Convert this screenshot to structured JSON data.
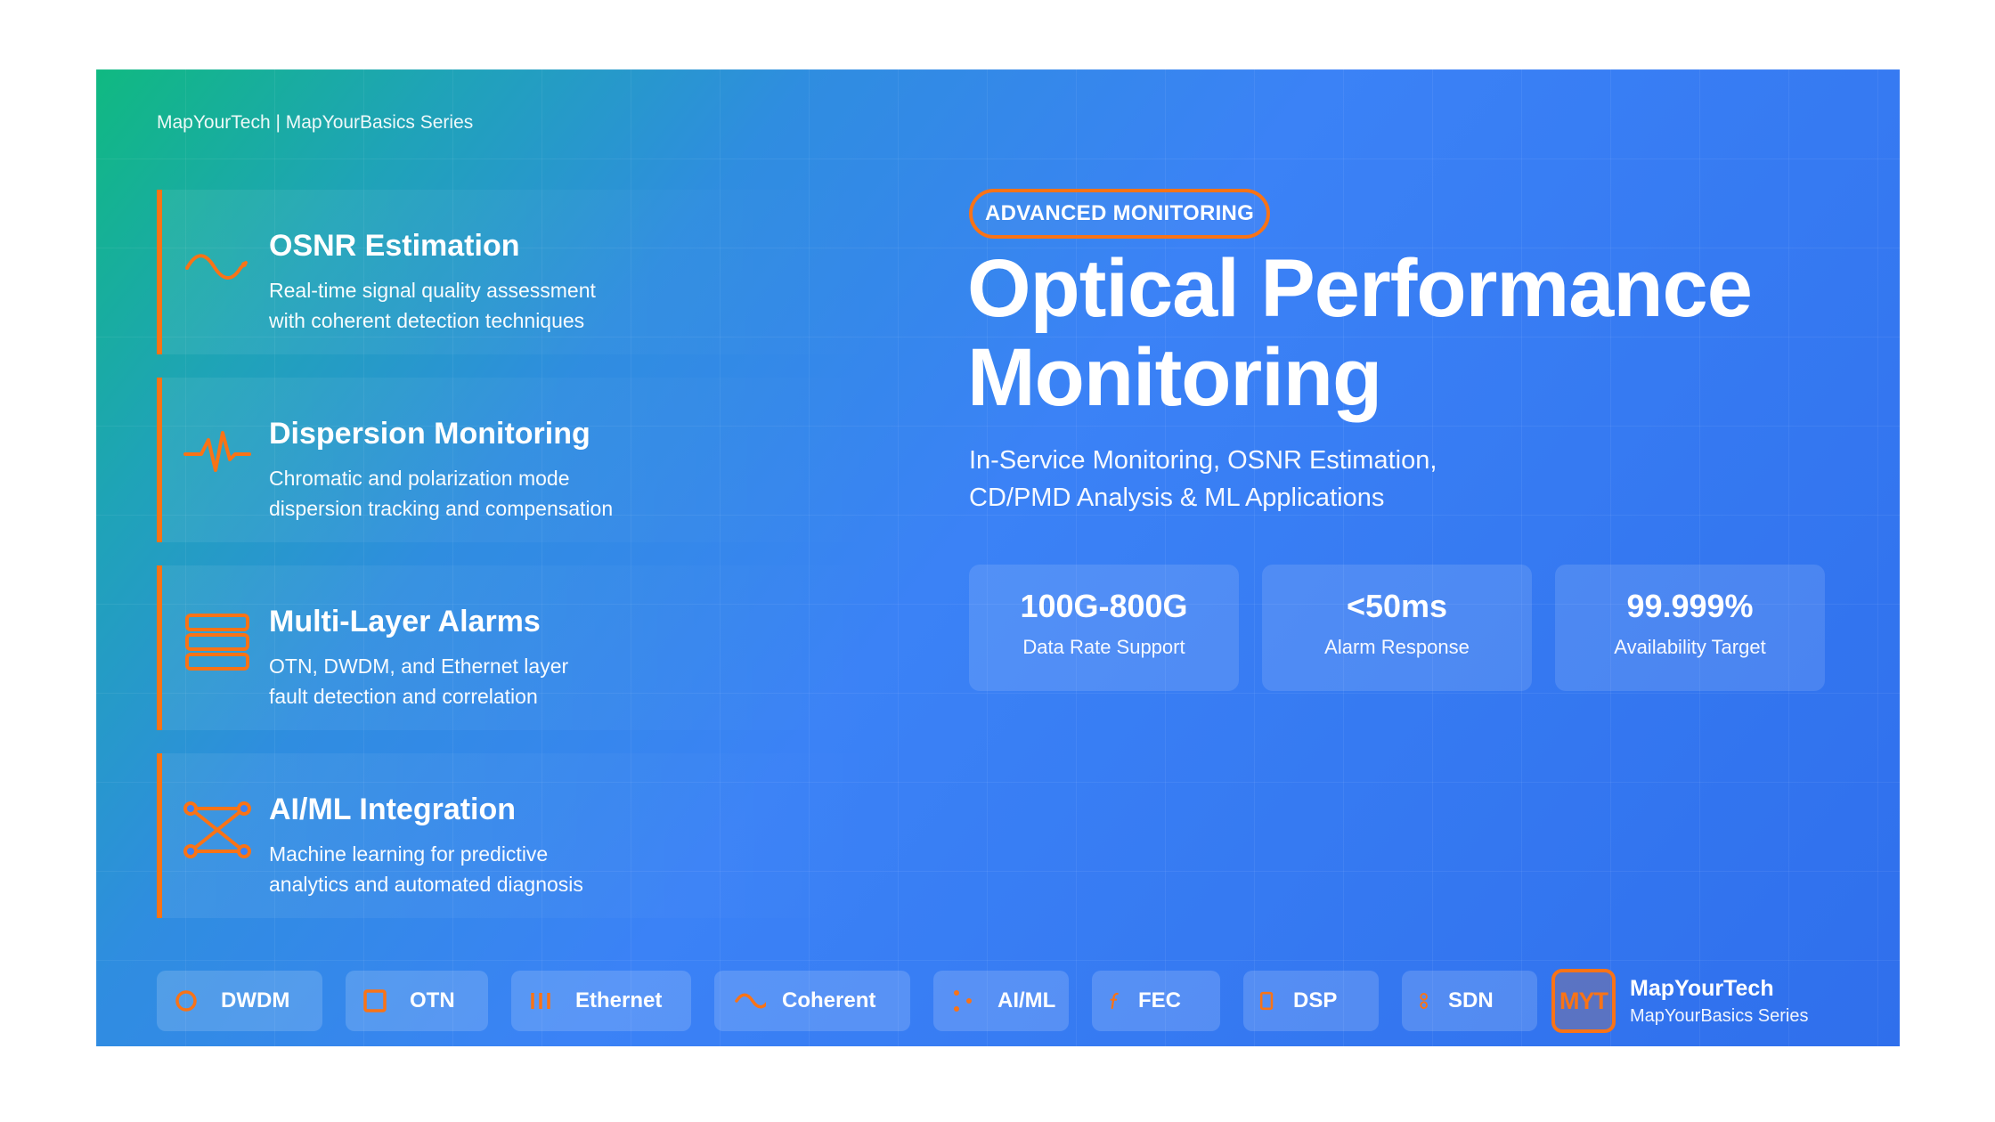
{
  "header": {
    "brand_line": "MapYourTech | MapYourBasics Series"
  },
  "features": [
    {
      "icon": "wave-icon",
      "title": "OSNR Estimation",
      "line1": "Real-time signal quality assessment",
      "line2": "with coherent detection techniques"
    },
    {
      "icon": "pulse-icon",
      "title": "Dispersion Monitoring",
      "line1": "Chromatic and polarization mode",
      "line2": "dispersion tracking and compensation"
    },
    {
      "icon": "layers-icon",
      "title": "Multi-Layer Alarms",
      "line1": "OTN, DWDM, and Ethernet layer",
      "line2": "fault detection and correlation"
    },
    {
      "icon": "network-icon",
      "title": "AI/ML Integration",
      "line1": "Machine learning for predictive",
      "line2": "analytics and automated diagnosis"
    }
  ],
  "hero": {
    "badge": "ADVANCED MONITORING",
    "title_line1": "Optical Performance",
    "title_line2": "Monitoring",
    "subtitle_line1": "In-Service Monitoring, OSNR Estimation,",
    "subtitle_line2": "CD/PMD Analysis & ML Applications"
  },
  "stats": [
    {
      "value": "100G-800G",
      "label": "Data Rate Support"
    },
    {
      "value": "<50ms",
      "label": "Alarm Response"
    },
    {
      "value": "99.999%",
      "label": "Availability Target"
    }
  ],
  "tags": [
    {
      "label": "DWDM",
      "icon": "ring-icon"
    },
    {
      "label": "OTN",
      "icon": "square-icon"
    },
    {
      "label": "Ethernet",
      "icon": "bars-icon"
    },
    {
      "label": "Coherent",
      "icon": "wave-icon"
    },
    {
      "label": "AI/ML",
      "icon": "dots-icon"
    },
    {
      "label": "FEC",
      "icon": "function-icon"
    },
    {
      "label": "DSP",
      "icon": "chip-icon"
    },
    {
      "label": "SDN",
      "icon": "link-icon"
    }
  ],
  "logo": {
    "mark": "MYT",
    "name": "MapYourTech",
    "series": "MapYourBasics Series"
  },
  "colors": {
    "accent": "#f97316",
    "gradient_start": "#10b981",
    "gradient_mid": "#3b82f6",
    "gradient_end": "#2f6fec"
  }
}
